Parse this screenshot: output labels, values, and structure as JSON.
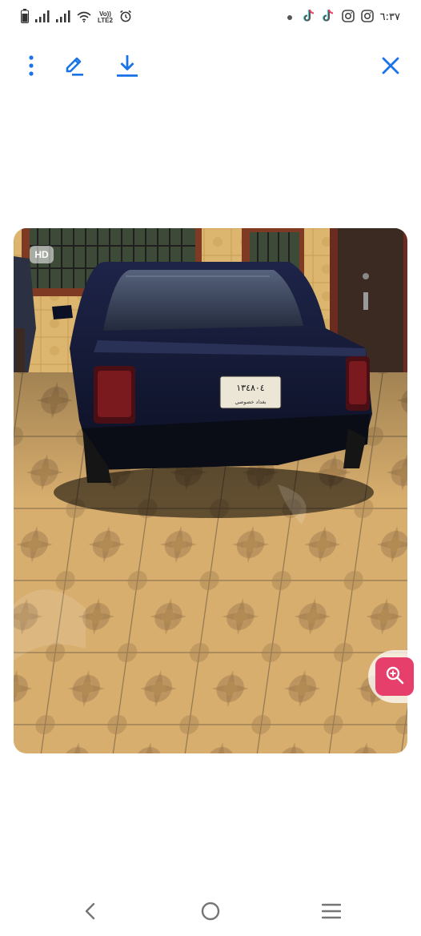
{
  "status_bar": {
    "time": "٦:٣٧",
    "network_label_top": "Vo))",
    "network_label_bottom": "LTE2",
    "icons_left": [
      "battery-icon",
      "signal-icon",
      "signal-icon",
      "wifi-icon",
      "volte-icon",
      "alarm-icon"
    ],
    "icons_right": [
      "notification-dot-icon",
      "tiktok-icon",
      "tiktok-icon",
      "instagram-icon",
      "instagram-icon"
    ]
  },
  "toolbar": {
    "items": [
      "more-vert-icon",
      "edit-icon",
      "download-icon",
      "close-icon"
    ],
    "accent_color": "#1a73e8"
  },
  "photo": {
    "badge": "HD",
    "plate_text": "١٣٤٨٠٤",
    "plate_sub": "بغداد خصوصي"
  },
  "lens_button": {
    "icon": "zoom-in-icon",
    "color": "#e63f6b"
  },
  "nav_bar": {
    "items": [
      "back-icon",
      "home-icon",
      "recents-icon"
    ],
    "color": "#757575"
  }
}
